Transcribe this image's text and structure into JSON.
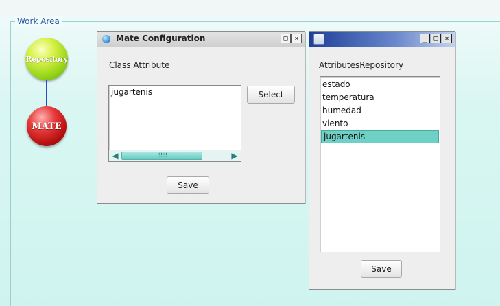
{
  "work_area": {
    "title": "Work Area"
  },
  "nodes": {
    "repository_label": "Repository",
    "mate_label": "MATE"
  },
  "mate_window": {
    "title": "Mate Configuration",
    "class_attribute_label": "Class Attribute",
    "list_items": [
      "jugartenis"
    ],
    "select_label": "Select",
    "save_label": "Save",
    "titlebar_buttons": [
      "□",
      "×"
    ]
  },
  "repo_window": {
    "title": "",
    "header_label": "AttributesRepository",
    "list_items": [
      "estado",
      "temperatura",
      "humedad",
      "viento",
      "jugartenis"
    ],
    "selected_item": "jugartenis",
    "save_label": "Save",
    "titlebar_buttons": [
      "_",
      "□",
      "×"
    ]
  },
  "colors": {
    "work_area_bg": "#cff4ef",
    "selection": "#6fd1c6",
    "group_title": "#2f58a8",
    "repo_node": "#9ad61a",
    "mate_node": "#b50f0f"
  }
}
